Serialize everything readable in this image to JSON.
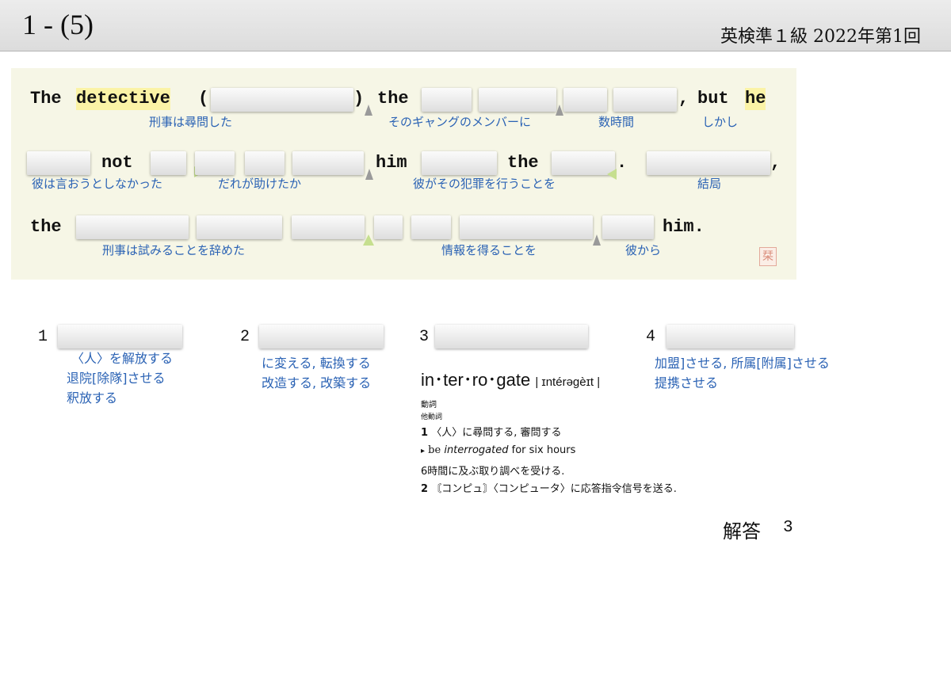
{
  "header": {
    "question_number": "1 - (5)",
    "exam_info": "英検準１級  2022年第1回"
  },
  "sentence": {
    "line1": {
      "the": "The",
      "detective": "detective",
      "paren_open": "(",
      "paren_close": ")",
      "the2": "the",
      "comma": ",",
      "but": "but",
      "he": "he"
    },
    "line2": {
      "not": "not",
      "him": "him",
      "the": "the",
      "period": ".",
      "comma": ","
    },
    "line3": {
      "the": "the",
      "him": "him."
    },
    "glosses": {
      "g1": "刑事は尋問した",
      "g2": "そのギャングのメンバーに",
      "g3": "数時間",
      "g4": "しかし",
      "g5": "彼は言おうとしなかった",
      "g6": "だれが助けたか",
      "g7": "彼がその犯罪を行うことを",
      "g8": "結局",
      "g9": "刑事は試みることを辞めた",
      "g10": "情報を得ることを",
      "g11": "彼から"
    },
    "seal_glyph": "栞"
  },
  "choices": [
    {
      "number": "1",
      "meanings": [
        "〈人〉を解放する",
        "退院[除隊]させる",
        "釈放する"
      ]
    },
    {
      "number": "2",
      "meanings": [
        "に変える, 転換する",
        "改造する, 改築する"
      ]
    },
    {
      "number": "3",
      "meanings": []
    },
    {
      "number": "4",
      "meanings": [
        "加盟]させる, 所属[附属]させる",
        "提携させる"
      ]
    }
  ],
  "dictionary": {
    "headword": "in･ter･ro･gate",
    "pronunciation": "| ɪntérəgèɪt |",
    "pos": "動詞",
    "subpos": "他動詞",
    "sense1_num": "1",
    "sense1": "〈人〉に尋問する, 審問する",
    "example_marker": "▸",
    "example_pre": "be ",
    "example_em": "interrogated",
    "example_post": " for six hours",
    "example_translation": "6時間に及ぶ取り調べを受ける.",
    "sense2_num": "2",
    "sense2": "〘コンピュ〙〈コンピュータ〉に応答指令信号を送る."
  },
  "answer": {
    "label": "解答",
    "value": "3"
  }
}
